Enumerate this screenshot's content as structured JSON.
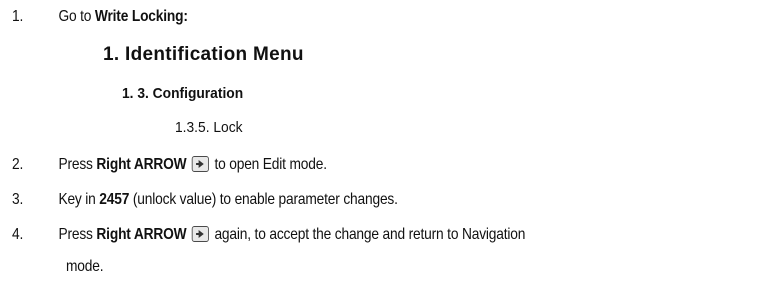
{
  "steps": [
    {
      "number": "1.",
      "before": "Go to ",
      "bold": "Write Locking:"
    },
    {
      "number": "2.",
      "before": "Press ",
      "bold": "Right ARROW",
      "after": " to open Edit mode."
    },
    {
      "number": "3.",
      "before": "Key in ",
      "bold": "2457",
      "after": " (unlock value) to enable parameter changes."
    },
    {
      "number": "4.",
      "before": "Press ",
      "bold": "Right ARROW",
      "after": " again, to accept the change and return to Navigation",
      "continuation": "mode."
    }
  ],
  "menu_path": {
    "level1": "1. Identification Menu",
    "level2": "1. 3. Configuration",
    "level3": "1.3.5. Lock"
  },
  "icons": {
    "right_arrow_key": "right-arrow-key-icon"
  }
}
